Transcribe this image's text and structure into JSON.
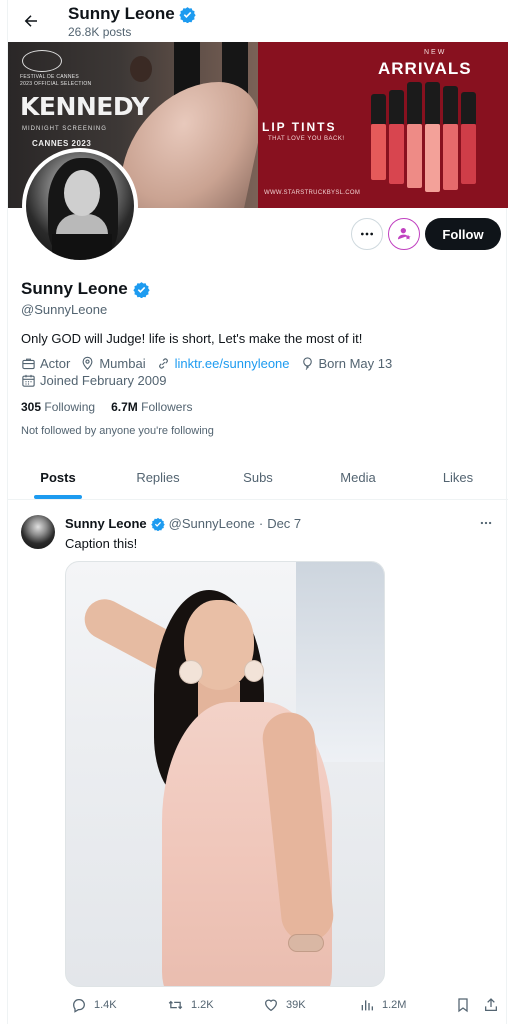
{
  "header": {
    "title": "Sunny Leone",
    "posts_count": "26.8K posts"
  },
  "banner": {
    "left": {
      "festival_text": "FESTIVAL DE CANNES",
      "festival_subtext": "2023 OFFICIAL SELECTION",
      "title": "KENNEDY",
      "subtitle": "MIDNIGHT SCREENING",
      "edition": "CANNES 2023"
    },
    "right": {
      "kicker": "NEW",
      "headline": "ARRIVALS",
      "product": "LIP TINTS",
      "tagline": "THAT LOVE YOU BACK!",
      "website": "WWW.STARSTRUCKBYSL.COM"
    }
  },
  "profile": {
    "name": "Sunny Leone",
    "handle": "@SunnyLeone",
    "bio": "Only GOD will Judge! life is short, Let's make the most of it!",
    "occupation": "Actor",
    "location": "Mumbai",
    "link": "linktr.ee/sunnyleone",
    "born": "Born May 13",
    "joined": "Joined February 2009",
    "following_count": "305",
    "following_label": "Following",
    "followers_count": "6.7M",
    "followers_label": "Followers",
    "not_followed": "Not followed by anyone you're following",
    "follow_button": "Follow"
  },
  "tabs": [
    {
      "label": "Posts",
      "active": true
    },
    {
      "label": "Replies",
      "active": false
    },
    {
      "label": "Subs",
      "active": false
    },
    {
      "label": "Media",
      "active": false
    },
    {
      "label": "Likes",
      "active": false
    }
  ],
  "tweet": {
    "author": "Sunny Leone",
    "handle": "@SunnyLeone",
    "separator": "·",
    "date": "Dec 7",
    "text": "Caption this!",
    "replies": "1.4K",
    "retweets": "1.2K",
    "likes": "39K",
    "views": "1.2M"
  },
  "colors": {
    "accent": "#1d9bf0",
    "verified": "#1d9bf0",
    "follow_bg": "#0f1419",
    "subscribe_ring": "#c040c0",
    "banner_right_bg": "#88111f"
  },
  "icons": [
    "back-arrow-icon",
    "verified-icon",
    "more-icon",
    "subscribe-icon",
    "briefcase-icon",
    "location-icon",
    "link-icon",
    "balloon-icon",
    "calendar-icon",
    "reply-icon",
    "retweet-icon",
    "like-icon",
    "views-icon",
    "bookmark-icon",
    "share-icon"
  ]
}
